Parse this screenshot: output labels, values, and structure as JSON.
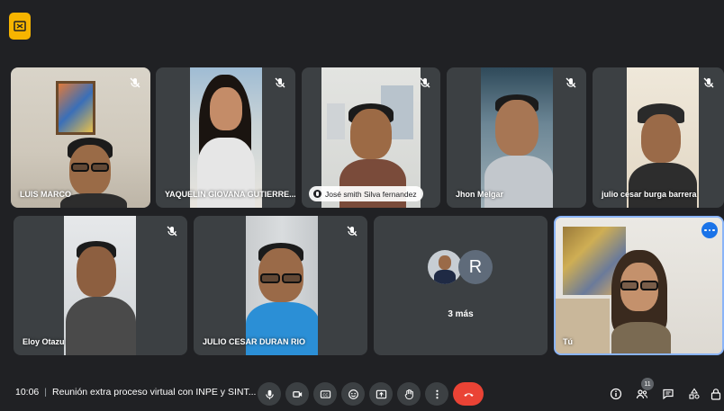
{
  "participants_row1": [
    {
      "name": "LUIS MARCO",
      "muted": true
    },
    {
      "name": "YAQUELIN GIOVANA GUTIERRE...",
      "muted": true
    },
    {
      "name": "José smith Silva fernandez",
      "speaking": true,
      "muted": true
    },
    {
      "name": "Jhon Melgar",
      "muted": true
    },
    {
      "name": "julio cesar burga barrera",
      "muted": true
    }
  ],
  "participants_row2": [
    {
      "name": "Eloy Otazu",
      "muted": true
    },
    {
      "name": "JULIO CESAR DURAN RIO",
      "muted": true
    }
  ],
  "more_tile": {
    "avatar_letter": "R",
    "label": "3 más"
  },
  "self_tile": {
    "name": "Tú"
  },
  "bottom": {
    "time": "10:06",
    "meeting_title": "Reunión extra proceso virtual con INPE y SINT...",
    "participant_count": "11"
  },
  "colors": {
    "background": "#202124",
    "tile": "#3c4043",
    "end_call": "#ea4335",
    "accent": "#8ab4f8",
    "badge": "#f6b400"
  }
}
